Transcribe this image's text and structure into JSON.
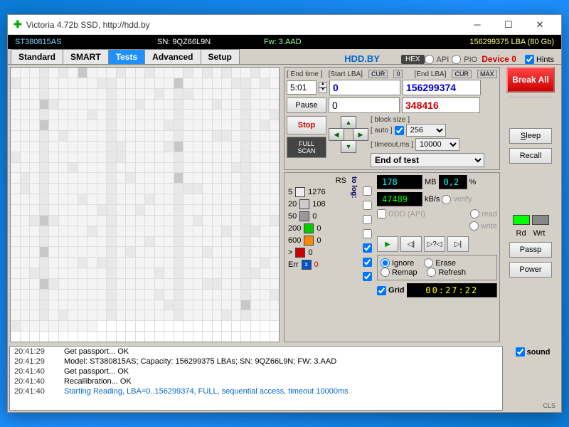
{
  "title": "Victoria 4.72b SSD, http://hdd.by",
  "info": {
    "model": "ST380815AS",
    "sn": "SN: 9QZ66L9N",
    "fw": "Fw: 3.AAD",
    "lba": "156299375 LBA (80 Gb)"
  },
  "tabs": [
    "Standard",
    "SMART",
    "Tests",
    "Advanced",
    "Setup"
  ],
  "hddby": "HDD.BY",
  "hex": "HEX",
  "api": "API",
  "pio": "PIO",
  "device": "Device 0",
  "hints": "Hints",
  "scan": {
    "endtime_lbl": "[ End time ]",
    "endtime": "5:01",
    "startlba_lbl": "[Start LBA]",
    "startlba": "0",
    "cur": "CUR",
    "zero": "0",
    "endlba_lbl": "[End LBA]",
    "endlba": "156299374",
    "max": "MAX",
    "pause": "Pause",
    "start2": "0",
    "current": "348416",
    "stop": "Stop",
    "fullscan": "FULL SCAN",
    "blocksize_lbl": "[ block size ]",
    "auto_lbl": "[ auto ]",
    "blocksize": "256",
    "timeout_lbl": "[ timeout,ms ]",
    "timeout": "10000",
    "endtest": "End of test"
  },
  "stats": {
    "rs": "RS",
    "tolog": "to log:",
    "t5": "5",
    "v5": "1276",
    "t20": "20",
    "v20": "108",
    "t50": "50",
    "v50": "0",
    "t200": "200",
    "v200": "0",
    "t600": "600",
    "v600": "0",
    "tgt": ">",
    "vgt": "0",
    "err": "Err",
    "errx": "x",
    "verr": "0",
    "mb": "178",
    "mblbl": "MB",
    "pct": "0,2",
    "pctlbl": "%",
    "kbs": "47489",
    "kbslbl": "kB/s",
    "ddd": "DDD (API)",
    "verify": "verify",
    "read": "read",
    "write": "write",
    "ignore": "Ignore",
    "erase": "Erase",
    "remap": "Remap",
    "refresh": "Refresh",
    "grid": "Grid",
    "timer": "00:27:22"
  },
  "right": {
    "breakall": "Break All",
    "sleep": "Sleep",
    "recall": "Recall",
    "rd": "Rd",
    "wrt": "Wrt",
    "passp": "Passp",
    "power": "Power",
    "sound": "sound",
    "cls": "CLS"
  },
  "log": [
    {
      "t": "20:41:29",
      "m": "Get passport... OK"
    },
    {
      "t": "20:41:29",
      "m": "Model: ST380815AS; Capacity: 156299375 LBAs; SN: 9QZ66L9N; FW: 3.AAD"
    },
    {
      "t": "20:41:40",
      "m": "Get passport... OK"
    },
    {
      "t": "20:41:40",
      "m": "Recallibration... OK"
    },
    {
      "t": "20:41:40",
      "m": "Starting Reading, LBA=0..156299374, FULL, sequential access, timeout 10000ms",
      "c": "blue"
    }
  ],
  "chart_data": {
    "type": "heatmap",
    "title": "Surface scan map",
    "note": "block latency grid, mostly <5ms with scattered 5-20ms and 20-50ms cells"
  }
}
